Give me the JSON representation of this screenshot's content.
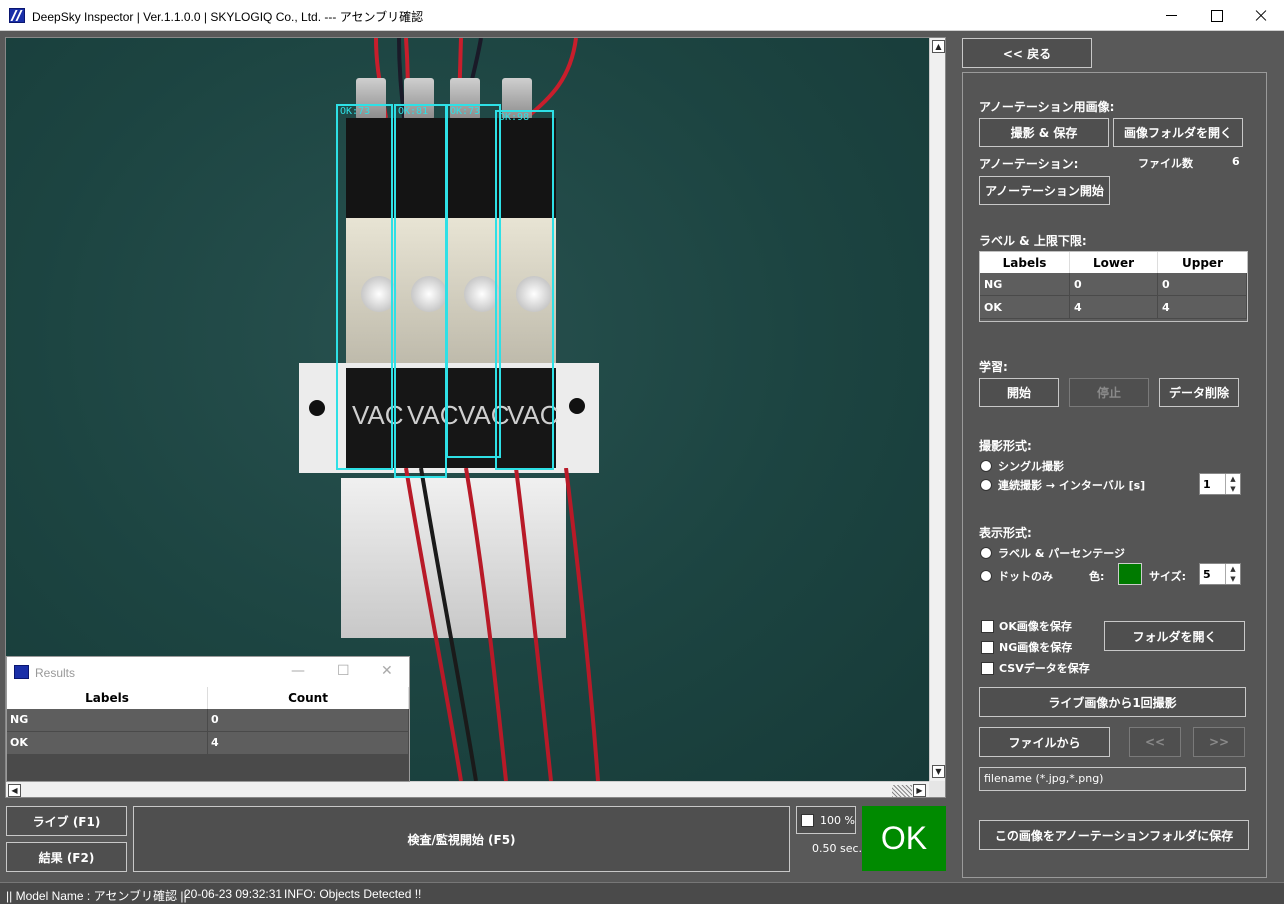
{
  "window": {
    "title": "DeepSky Inspector | Ver.1.1.0.0 | SKYLOGIQ Co., Ltd. --- アセンブリ確認"
  },
  "viewer": {
    "detections": [
      {
        "label": "OK:73"
      },
      {
        "label": "OK:81"
      },
      {
        "label": "OK:73"
      },
      {
        "label": "OK:98"
      }
    ],
    "module_text": "VAC"
  },
  "results_window": {
    "title": "Results",
    "columns": [
      "Labels",
      "Count"
    ],
    "rows": [
      {
        "label": "NG",
        "count": "0"
      },
      {
        "label": "OK",
        "count": "4"
      }
    ]
  },
  "bottom": {
    "live_button": "ライブ (F1)",
    "result_button": "結果 (F2)",
    "inspect_button": "検査/監視開始 (F5)",
    "zoom_label": "100 %",
    "elapsed": "0.50 sec.",
    "judgement": "OK",
    "judgement_color": "#008a00"
  },
  "right_panel": {
    "back_button": "<< 戻る",
    "annotation_image_heading": "アノーテーション用画像:",
    "capture_save_button": "撮影 & 保存",
    "open_image_folder_button": "画像フォルダを開く",
    "annotation_heading": "アノーテーション:",
    "file_count_label": "ファイル数",
    "file_count_value": "6",
    "start_annotation_button": "アノーテーション開始",
    "label_limits_heading": "ラベル & 上限下限:",
    "limits_table": {
      "columns": [
        "Labels",
        "Lower",
        "Upper"
      ],
      "rows": [
        {
          "label": "NG",
          "lower": "0",
          "upper": "0"
        },
        {
          "label": "OK",
          "lower": "4",
          "upper": "4"
        }
      ]
    },
    "learning_heading": "学習:",
    "start_button": "開始",
    "stop_button": "停止",
    "delete_data_button": "データ削除",
    "capture_mode_heading": "撮影形式:",
    "single_capture": "シングル撮影",
    "continuous_capture": "連続撮影 → インターバル [s]",
    "interval_value": "1",
    "display_mode_heading": "表示形式:",
    "label_percentage": "ラベル & パーセンテージ",
    "dot_only": "ドットのみ",
    "color_label": "色:",
    "dot_color": "#007a00",
    "size_label": "サイズ:",
    "size_value": "5",
    "save_ok_images": "OK画像を保存",
    "save_ng_images": "NG画像を保存",
    "save_csv": "CSVデータを保存",
    "open_folder_button": "フォルダを開く",
    "capture_from_live_button": "ライブ画像から1回撮影",
    "from_file_button": "ファイルから",
    "prev_button": "<<",
    "next_button": ">>",
    "filename_placeholder": "filename (*.jpg,*.png)",
    "save_to_annotation_button": "この画像をアノーテーションフォルダに保存"
  },
  "status_bar": {
    "model_name": "|| Model Name : アセンブリ確認 ||",
    "timestamp": "20-06-23 09:32:31",
    "info": "INFO:   Objects Detected !!"
  }
}
